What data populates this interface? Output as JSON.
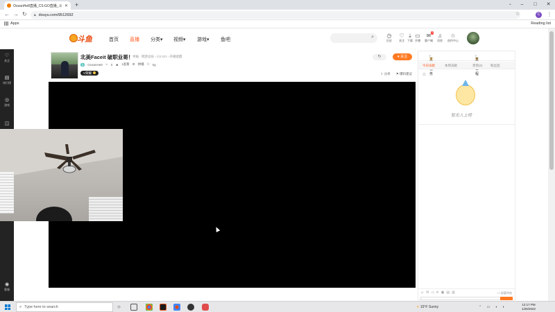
{
  "browser": {
    "tab_title": "OceanHe8直播_CS:GO直播_斗鱼...",
    "url": "douyu.com/9512692",
    "bookmark_apps": "Apps",
    "reading_list": "Reading list",
    "profile_initial": "C"
  },
  "site": {
    "logo_text": "斗鱼",
    "nav": [
      "首页",
      "直播",
      "分类",
      "视频",
      "游戏",
      "鱼吧"
    ],
    "nav_active_index": 1,
    "header_icons": [
      {
        "glyph": "◷",
        "label": "历史"
      },
      {
        "glyph": "♡",
        "label": "关注"
      },
      {
        "glyph": "⤓",
        "label": "下载"
      },
      {
        "glyph": "▭",
        "label": "开播"
      },
      {
        "glyph": "✉",
        "label": "客户端",
        "badge": "3"
      },
      {
        "glyph": "♫",
        "label": "消息"
      },
      {
        "glyph": "☆",
        "label": "创作中心"
      }
    ]
  },
  "leftrail": [
    {
      "glyph": "♡",
      "label": "关注"
    },
    {
      "glyph": "▤",
      "label": "排行榜"
    },
    {
      "glyph": "◎",
      "label": "游戏"
    },
    {
      "glyph": "◫",
      "label": ""
    },
    {
      "glyph": "◉",
      "label": "客服"
    }
  ],
  "room": {
    "title": "北美Faceit 破职业哥！",
    "category": "举报 · 网游竞技 › CS:GO › 开播提醒",
    "level": "5",
    "streamer": "OceanHe8",
    "heat": "0",
    "fans": "1查看",
    "likes": "拼播",
    "gifts": "0g",
    "rank_chip": "V荣耀",
    "refresh_glyph": "↻",
    "follow_label": "♥ 关注",
    "actions": [
      "分享",
      "爆料建议"
    ]
  },
  "rightpanel": {
    "head_left": "主播任务",
    "head_right": "直播日程",
    "tabs": [
      "今日贡献",
      "本周贡献",
      "贵宾(0)",
      "粉丝团"
    ],
    "active_tab_index": 0,
    "empty_text": "暂无人上榜",
    "block_label": "屏蔽特效"
  },
  "taskbar": {
    "search_placeholder": "Type here to search",
    "weather": "15°F Sunny",
    "time": "12:17 PM",
    "date": "1/26/2022"
  }
}
